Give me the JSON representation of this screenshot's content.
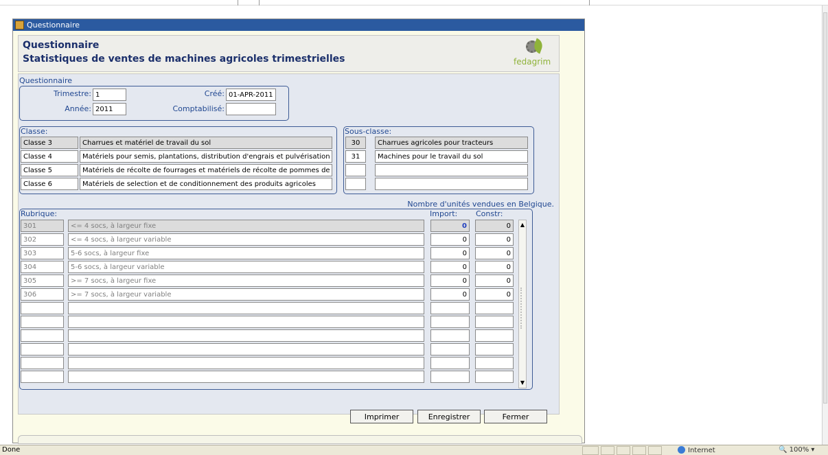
{
  "window": {
    "title": "Questionnaire"
  },
  "header": {
    "title": "Questionnaire",
    "subtitle": "Statistiques de ventes de machines agricoles trimestrielles",
    "logo_text": "fedagrim"
  },
  "questionnaire": {
    "section_label": "Questionnaire",
    "trimestre_label": "Trimestre:",
    "trimestre_value": "1",
    "annee_label": "Année:",
    "annee_value": "2011",
    "cree_label": "Créé:",
    "cree_value": "01-APR-2011",
    "comptabilise_label": "Comptabilisé:",
    "comptabilise_value": ""
  },
  "classe": {
    "label": "Classe:",
    "rows": [
      {
        "code": "Classe 3",
        "desc": "Charrues et matériel de travail du sol"
      },
      {
        "code": "Classe 4",
        "desc": "Matériels pour semis, plantations, distribution d'engrais et pulvérisation"
      },
      {
        "code": "Classe 5",
        "desc": "Matériels de récolte de fourrages et matériels de récolte de pommes de"
      },
      {
        "code": "Classe 6",
        "desc": "Matériels de selection et de conditionnement des produits agricoles"
      }
    ]
  },
  "sous_classe": {
    "label": "Sous-classe:",
    "rows": [
      {
        "code": "30",
        "desc": "Charrues agricoles pour tracteurs"
      },
      {
        "code": "31",
        "desc": "Machines pour le travail du sol"
      },
      {
        "code": "",
        "desc": ""
      },
      {
        "code": "",
        "desc": ""
      }
    ]
  },
  "units_note": "Nombre d'unités vendues en Belgique.",
  "rubrique": {
    "label": "Rubrique:",
    "import_label": "Import:",
    "constr_label": "Constr:",
    "rows": [
      {
        "code": "301",
        "desc": "<= 4 socs, à largeur fixe",
        "import": "0",
        "constr": "0"
      },
      {
        "code": "302",
        "desc": "<= 4 socs, à largeur variable",
        "import": "0",
        "constr": "0"
      },
      {
        "code": "303",
        "desc": "5-6 socs, à largeur fixe",
        "import": "0",
        "constr": "0"
      },
      {
        "code": "304",
        "desc": "5-6 socs, à largeur variable",
        "import": "0",
        "constr": "0"
      },
      {
        "code": "305",
        "desc": ">= 7 socs, à largeur fixe",
        "import": "0",
        "constr": "0"
      },
      {
        "code": "306",
        "desc": ">= 7 socs, à largeur variable",
        "import": "0",
        "constr": "0"
      },
      {
        "code": "",
        "desc": "",
        "import": "",
        "constr": ""
      },
      {
        "code": "",
        "desc": "",
        "import": "",
        "constr": ""
      },
      {
        "code": "",
        "desc": "",
        "import": "",
        "constr": ""
      },
      {
        "code": "",
        "desc": "",
        "import": "",
        "constr": ""
      },
      {
        "code": "",
        "desc": "",
        "import": "",
        "constr": ""
      },
      {
        "code": "",
        "desc": "",
        "import": "",
        "constr": ""
      }
    ]
  },
  "buttons": {
    "print": "Imprimer",
    "save": "Enregistrer",
    "close": "Fermer"
  },
  "statusbar": {
    "status": "Done",
    "zone": "Internet",
    "zoom": "100%"
  },
  "colors": {
    "titlebar": "#2b5aa0",
    "label_blue": "#1f4690",
    "focus": "#1f3fbf"
  }
}
